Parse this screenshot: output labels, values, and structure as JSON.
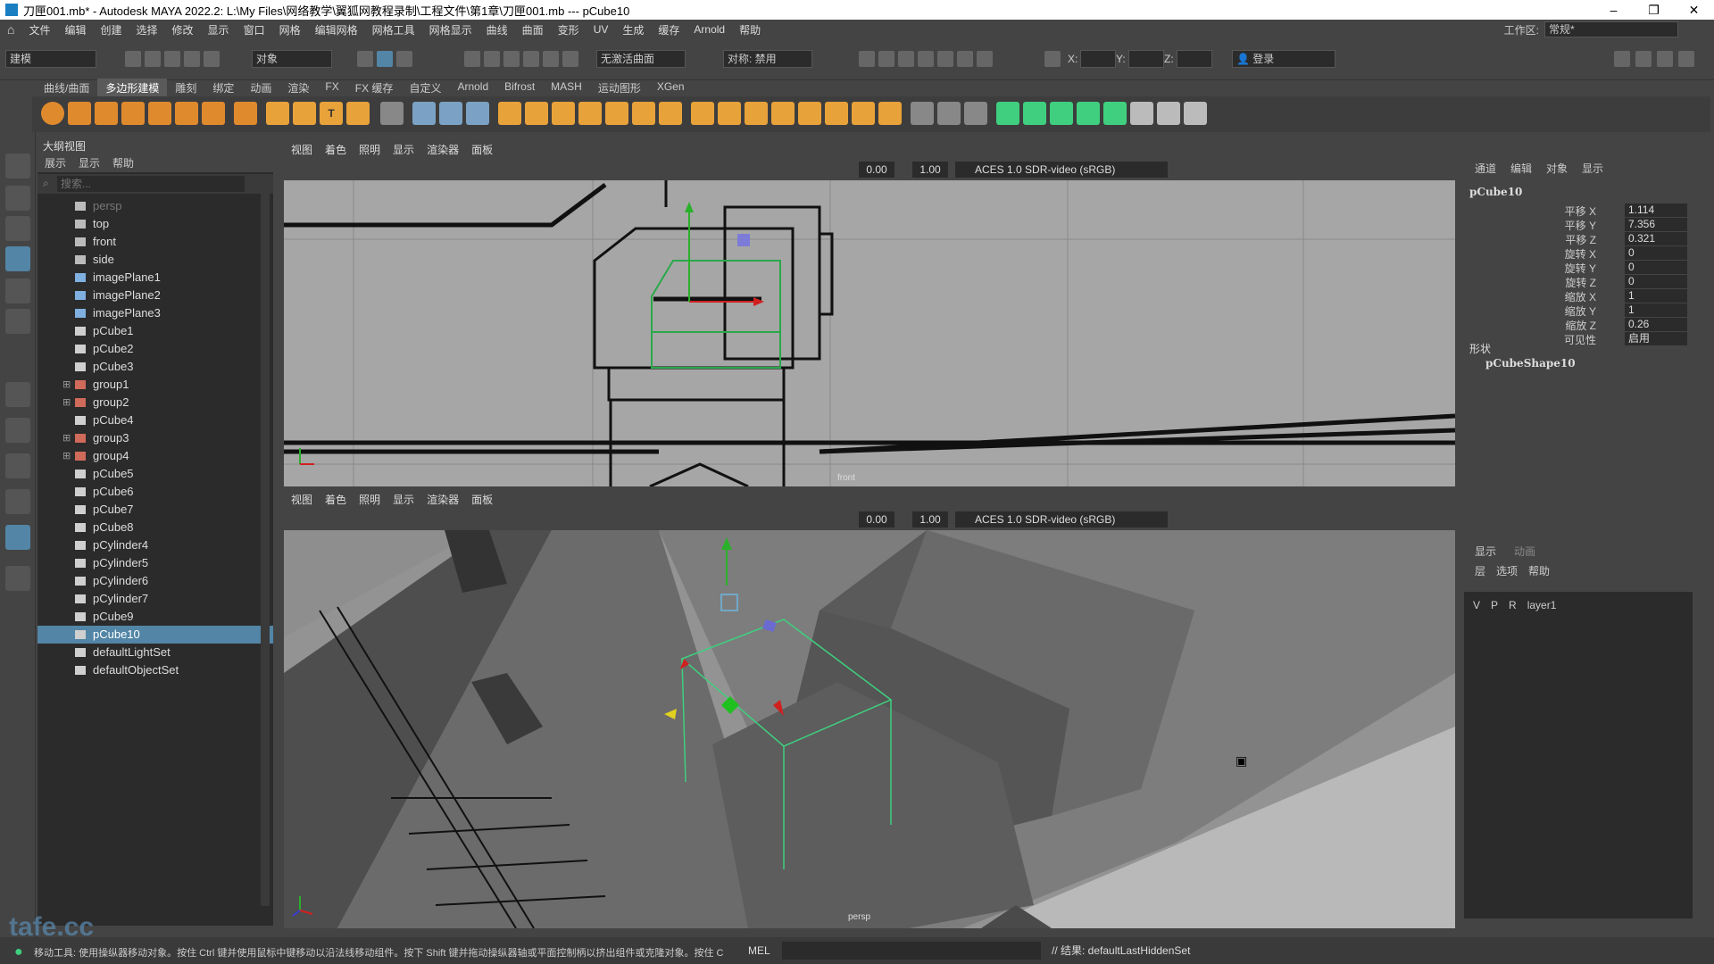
{
  "window": {
    "title": "刀匣001.mb* - Autodesk MAYA 2022.2: L:\\My Files\\网络教学\\翼狐网教程录制\\工程文件\\第1章\\刀匣001.mb  ---  pCube10",
    "minimize": "–",
    "restore": "❐",
    "close": "✕"
  },
  "menubar": {
    "items": [
      "文件",
      "编辑",
      "创建",
      "选择",
      "修改",
      "显示",
      "窗口",
      "网格",
      "编辑网格",
      "网格工具",
      "网格显示",
      "曲线",
      "曲面",
      "变形",
      "UV",
      "生成",
      "缓存",
      "Arnold",
      "帮助"
    ],
    "workspace_label": "工作区:",
    "workspace_value": "常规*"
  },
  "statusline": {
    "mode": "建模",
    "selection_mask": "对象",
    "live_surface": "无激活曲面",
    "symmetry": "对称: 禁用",
    "x_label": "X:",
    "y_label": "Y:",
    "z_label": "Z:",
    "login": "登录"
  },
  "shelf": {
    "tabs": [
      "曲线/曲面",
      "多边形建模",
      "雕刻",
      "绑定",
      "动画",
      "渲染",
      "FX",
      "FX 缓存",
      "自定义",
      "Arnold",
      "Bifrost",
      "MASH",
      "运动图形",
      "XGen"
    ],
    "active_tab": "多边形建模"
  },
  "outliner": {
    "title": "大纲视图",
    "menus": [
      "展示",
      "显示",
      "帮助"
    ],
    "search_placeholder": "搜索...",
    "items": [
      {
        "label": "persp",
        "type": "camera",
        "dim": true
      },
      {
        "label": "top",
        "type": "camera"
      },
      {
        "label": "front",
        "type": "camera"
      },
      {
        "label": "side",
        "type": "camera"
      },
      {
        "label": "imagePlane1",
        "type": "image"
      },
      {
        "label": "imagePlane2",
        "type": "image"
      },
      {
        "label": "imagePlane3",
        "type": "image"
      },
      {
        "label": "pCube1",
        "type": "mesh"
      },
      {
        "label": "pCube2",
        "type": "mesh"
      },
      {
        "label": "pCube3",
        "type": "mesh"
      },
      {
        "label": "group1",
        "type": "group",
        "expandable": true
      },
      {
        "label": "group2",
        "type": "group",
        "expandable": true
      },
      {
        "label": "pCube4",
        "type": "mesh"
      },
      {
        "label": "group3",
        "type": "group",
        "expandable": true
      },
      {
        "label": "group4",
        "type": "group",
        "expandable": true
      },
      {
        "label": "pCube5",
        "type": "mesh"
      },
      {
        "label": "pCube6",
        "type": "mesh"
      },
      {
        "label": "pCube7",
        "type": "mesh"
      },
      {
        "label": "pCube8",
        "type": "mesh"
      },
      {
        "label": "pCylinder4",
        "type": "mesh"
      },
      {
        "label": "pCylinder5",
        "type": "mesh"
      },
      {
        "label": "pCylinder6",
        "type": "mesh"
      },
      {
        "label": "pCylinder7",
        "type": "mesh"
      },
      {
        "label": "pCube9",
        "type": "mesh"
      },
      {
        "label": "pCube10",
        "type": "mesh",
        "selected": true
      },
      {
        "label": "defaultLightSet",
        "type": "set"
      },
      {
        "label": "defaultObjectSet",
        "type": "set"
      }
    ]
  },
  "viewport_top": {
    "menus": [
      "视图",
      "着色",
      "照明",
      "显示",
      "渲染器",
      "面板"
    ],
    "exposure": "0.00",
    "gamma": "1.00",
    "color_space": "ACES 1.0 SDR-video (sRGB)",
    "camera_label": "front"
  },
  "viewport_bottom": {
    "menus": [
      "视图",
      "着色",
      "照明",
      "显示",
      "渲染器",
      "面板"
    ],
    "exposure": "0.00",
    "gamma": "1.00",
    "color_space": "ACES 1.0 SDR-video (sRGB)",
    "camera_label": "persp"
  },
  "channelbox": {
    "tabs": [
      "通道",
      "编辑",
      "对象",
      "显示"
    ],
    "object_name": "pCube10",
    "attributes": [
      {
        "label": "平移 X",
        "value": "1.114"
      },
      {
        "label": "平移 Y",
        "value": "7.356"
      },
      {
        "label": "平移 Z",
        "value": "0.321"
      },
      {
        "label": "旋转 X",
        "value": "0"
      },
      {
        "label": "旋转 Y",
        "value": "0"
      },
      {
        "label": "旋转 Z",
        "value": "0"
      },
      {
        "label": "缩放 X",
        "value": "1"
      },
      {
        "label": "缩放 Y",
        "value": "1"
      },
      {
        "label": "缩放 Z",
        "value": "0.26"
      },
      {
        "label": "可见性",
        "value": "启用"
      }
    ],
    "shapes_label": "形状",
    "shape_name": "pCubeShape10"
  },
  "layer_editor": {
    "tabs": [
      "显示",
      "动画"
    ],
    "menus": [
      "层",
      "选项",
      "帮助"
    ],
    "layer": {
      "v": "V",
      "p": "P",
      "r": "R",
      "name": "layer1"
    }
  },
  "helpline": {
    "text": "移动工具: 使用操纵器移动对象。按住 Ctrl 键并使用鼠标中键移动以沿法线移动组件。按下 Shift 键并拖动操纵器轴或平面控制柄以挤出组件或克隆对象。按住 C",
    "mel": "MEL",
    "result": "// 结果: defaultLastHiddenSet"
  },
  "watermark": "tafe.cc",
  "colors": {
    "selection": "#5285a6",
    "viewport_bg": "#a3a3a3",
    "accent_green": "#3fcf7f"
  }
}
